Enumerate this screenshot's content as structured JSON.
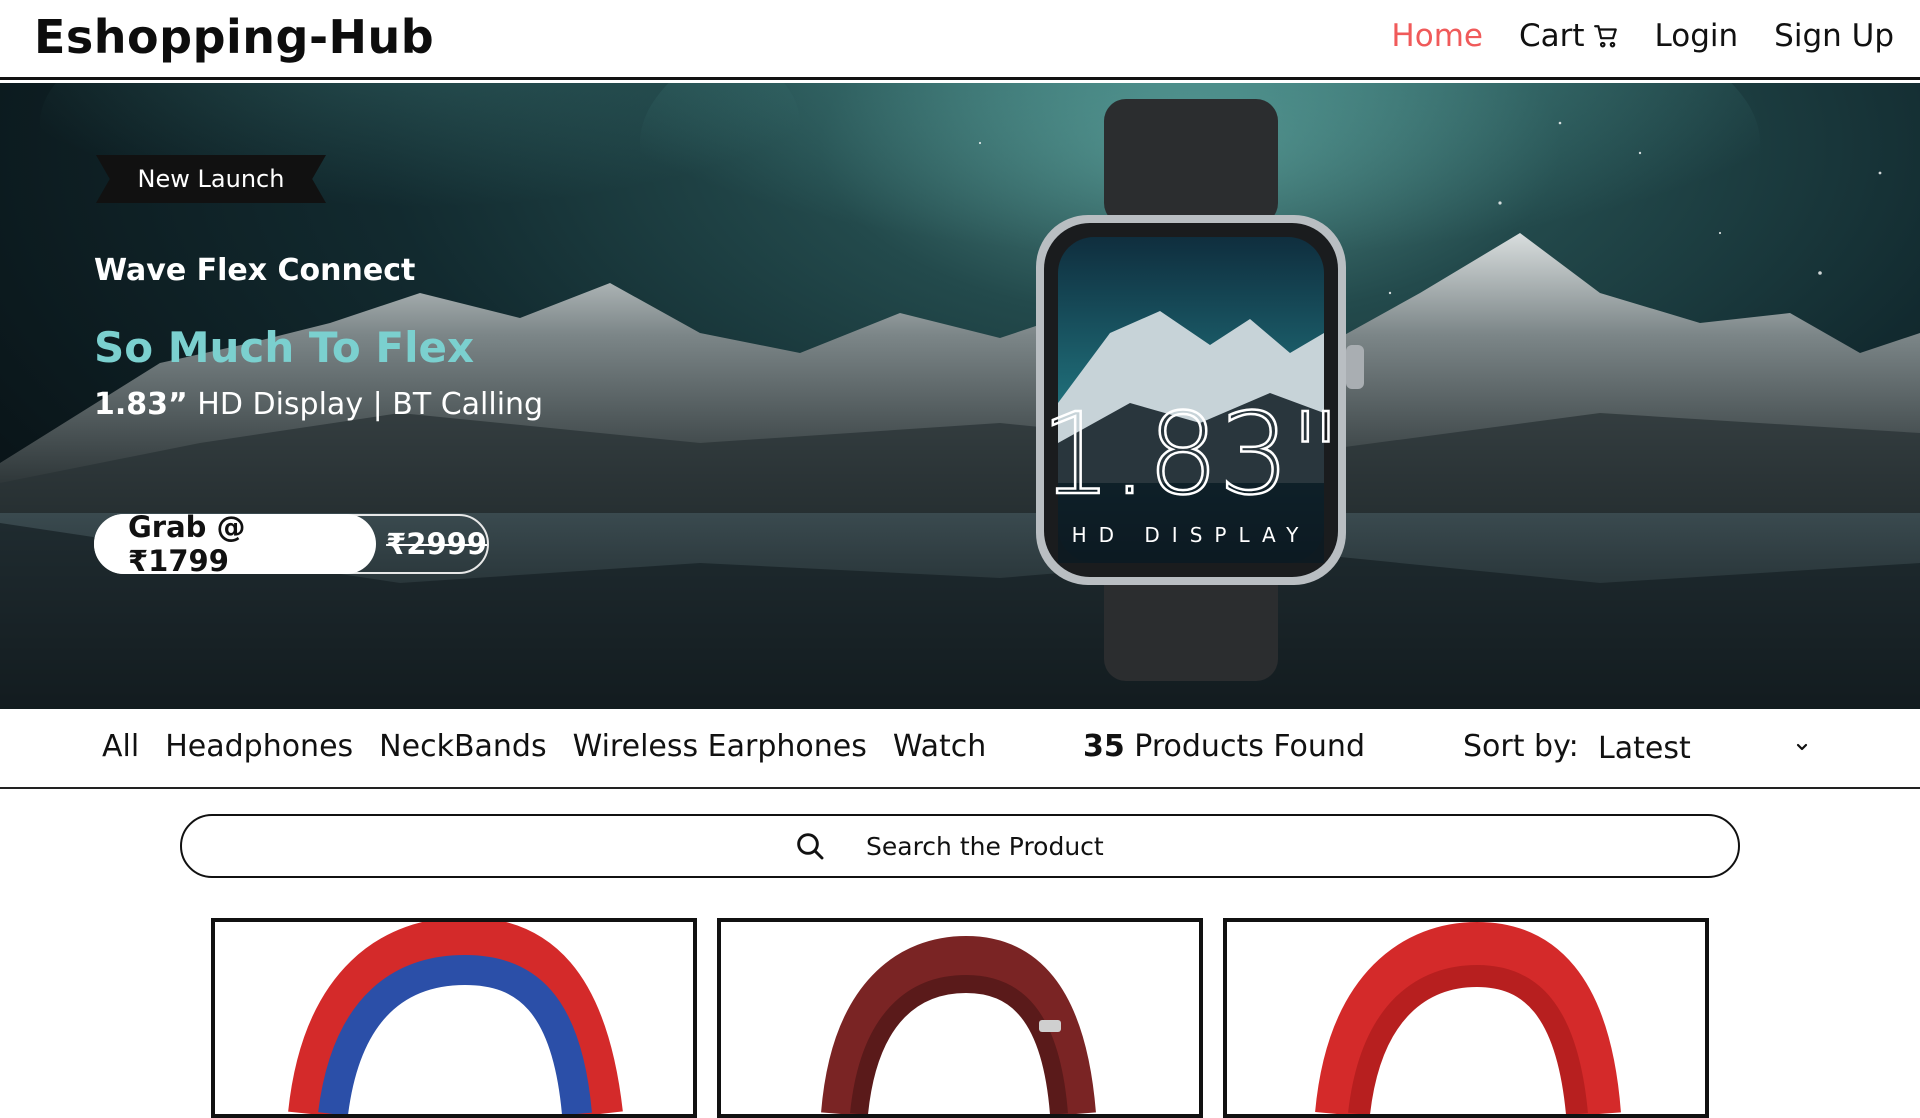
{
  "header": {
    "brand": "Eshopping-Hub",
    "nav": [
      {
        "label": "Home",
        "active": true
      },
      {
        "label": "Cart",
        "icon": "cart-icon"
      },
      {
        "label": "Login"
      },
      {
        "label": "Sign Up"
      }
    ]
  },
  "hero": {
    "badge": "New Launch",
    "product_name": "Wave Flex Connect",
    "tagline": "So Much To Flex",
    "spec_size": "1.83”",
    "spec_rest": "HD Display |  BT Calling",
    "price_label": "Grab @ ₹1799",
    "old_price": "₹2999",
    "watch_face_number": "1.83\"",
    "watch_face_text": "HD DISPLAY",
    "colors": {
      "tagline": "#7bd0cf",
      "background": "#122a2f"
    }
  },
  "filters": {
    "categories": [
      "All",
      "Headphones",
      "NeckBands",
      "Wireless Earphones",
      "Watch"
    ],
    "found_count": "35",
    "found_label": "Products Found",
    "sort_label": "Sort by:",
    "sort_value": "Latest"
  },
  "search": {
    "placeholder": "Search the Product"
  },
  "products": [
    {
      "image": "red-blue-headphone",
      "band_color": "#d42a2a",
      "inner_color": "#2b4fa8"
    },
    {
      "image": "maroon-headphone",
      "band_color": "#7a2424",
      "inner_color": "#5a1a1a"
    },
    {
      "image": "red-headphone",
      "band_color": "#d42a2a",
      "inner_color": "#b71f1f"
    }
  ],
  "theme": {
    "accent": "#f05a5a",
    "text": "#111111"
  }
}
